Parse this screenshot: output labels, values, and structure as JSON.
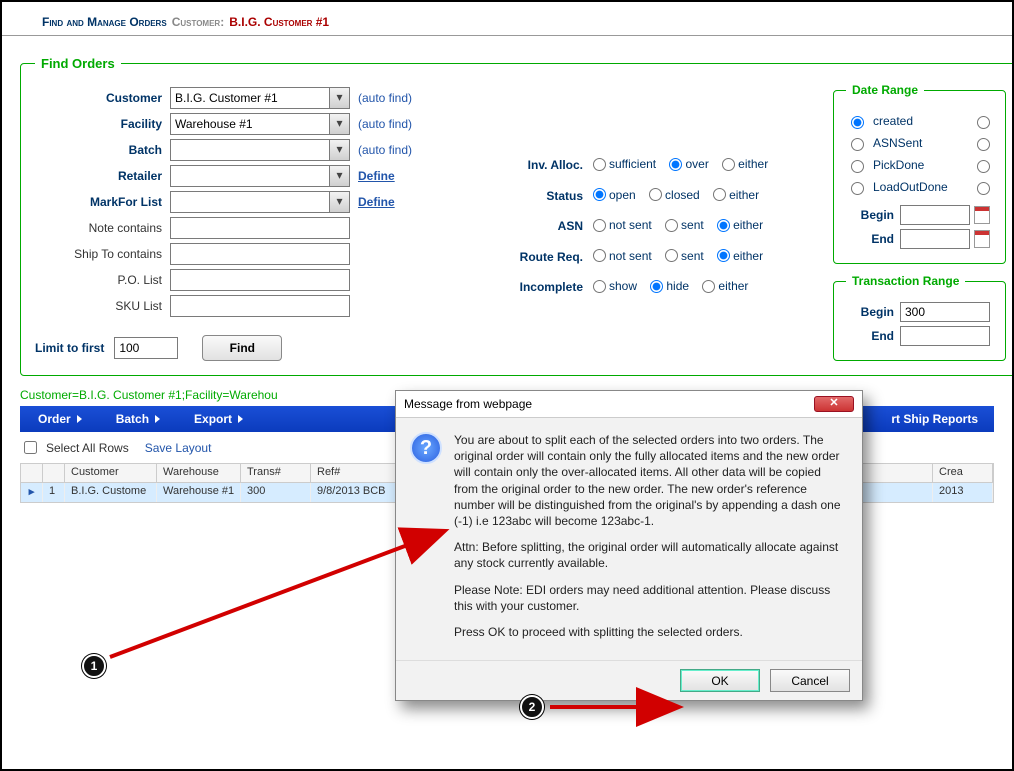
{
  "header": {
    "title": "Find and Manage Orders",
    "customer_label": "Customer:",
    "customer_name": "B.I.G. Customer #1"
  },
  "find": {
    "legend": "Find Orders",
    "customer": {
      "label": "Customer",
      "value": "B.I.G. Customer #1",
      "auto": "(auto find)"
    },
    "facility": {
      "label": "Facility",
      "value": "Warehouse #1",
      "auto": "(auto find)"
    },
    "batch": {
      "label": "Batch",
      "value": "",
      "auto": "(auto find)"
    },
    "retailer": {
      "label": "Retailer",
      "value": "",
      "define": "Define"
    },
    "markfor": {
      "label": "MarkFor List",
      "value": "",
      "define": "Define"
    },
    "note": {
      "label": "Note contains",
      "value": ""
    },
    "shipto": {
      "label": "Ship To contains",
      "value": ""
    },
    "polist": {
      "label": "P.O. List",
      "value": ""
    },
    "skulist": {
      "label": "SKU List",
      "value": ""
    },
    "limit": {
      "label": "Limit to first",
      "value": "100",
      "find_btn": "Find"
    }
  },
  "filters": {
    "inv": {
      "label": "Inv. Alloc.",
      "opts": [
        "sufficient",
        "over",
        "either"
      ],
      "sel": "over"
    },
    "status": {
      "label": "Status",
      "opts": [
        "open",
        "closed",
        "either"
      ],
      "sel": "open"
    },
    "asn": {
      "label": "ASN",
      "opts": [
        "not sent",
        "sent",
        "either"
      ],
      "sel": "either"
    },
    "route": {
      "label": "Route Req.",
      "opts": [
        "not sent",
        "sent",
        "either"
      ],
      "sel": "either"
    },
    "incomp": {
      "label": "Incomplete",
      "opts": [
        "show",
        "hide",
        "either"
      ],
      "sel": "hide"
    }
  },
  "date": {
    "legend": "Date Range",
    "opts": [
      "created",
      "ASNSent",
      "PickDone",
      "LoadOutDone"
    ],
    "sel": "created",
    "begin": "Begin",
    "end": "End",
    "begin_val": "",
    "end_val": ""
  },
  "trans": {
    "legend": "Transaction Range",
    "begin": "Begin",
    "begin_val": "300",
    "end": "End",
    "end_val": ""
  },
  "summary": "Customer=B.I.G. Customer #1;Facility=Warehou",
  "menu": [
    "Order",
    "Batch",
    "Export",
    "rt Ship Reports"
  ],
  "meta": {
    "select_all": "Select All Rows",
    "save_layout": "Save Layout"
  },
  "grid": {
    "cols": [
      "",
      "",
      "Customer",
      "Warehouse",
      "Trans#",
      "Ref#",
      "Crea"
    ],
    "row": {
      "idx": "1",
      "customer": "B.I.G. Custome",
      "warehouse": "Warehouse #1",
      "trans": "300",
      "ref": "9/8/2013 BCB",
      "crea": "2013"
    }
  },
  "dialog": {
    "title": "Message from webpage",
    "p1": "You are about to split each of the selected orders into two orders.  The original order will contain only the fully allocated items and the new order will contain only the over-allocated items.  All other data will be copied from the original order to the new order. The new order's reference number will be distinguished from the original's by appending a dash one (-1)  i.e 123abc will become 123abc-1.",
    "p2": "Attn: Before splitting, the original order will automatically allocate against any stock currently available.",
    "p3": "Please Note: EDI orders may need additional attention.  Please discuss this with your customer.",
    "p4": "Press OK to proceed with splitting the selected orders.",
    "ok": "OK",
    "cancel": "Cancel"
  },
  "annot": {
    "m1": "1",
    "m2": "2"
  }
}
